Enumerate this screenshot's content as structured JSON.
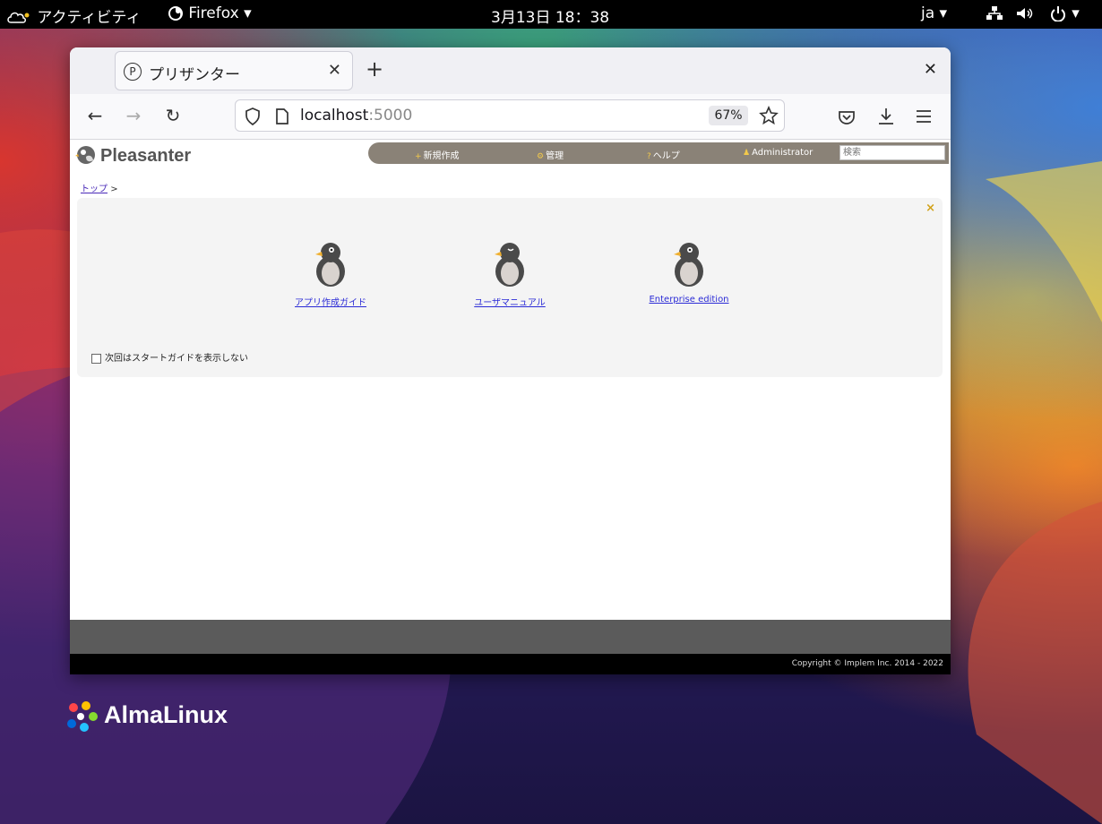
{
  "desktop": {
    "activities_label": "アクティビティ",
    "app_menu_label": "Firefox",
    "clock": "3月13日 18：38",
    "input_method": "ja",
    "distro_name": "AlmaLinux"
  },
  "browser": {
    "tab_title": "プリザンター",
    "url_host": "localhost",
    "url_port": ":5000",
    "zoom": "67%"
  },
  "app": {
    "logo_text": "Pleasanter",
    "menu": {
      "new_label": "新規作成",
      "manage_label": "管理",
      "help_label": "ヘルプ",
      "user_label": "Administrator"
    },
    "search_placeholder": "検索",
    "breadcrumb": {
      "top_label": "トップ",
      "separator": ">"
    },
    "guide": {
      "close_symbol": "×",
      "items": [
        {
          "label": "アプリ作成ガイド"
        },
        {
          "label": "ユーザマニュアル"
        },
        {
          "label": "Enterprise edition"
        }
      ],
      "dont_show_label": "次回はスタートガイドを表示しない"
    },
    "copyright": "Copyright © Implem Inc. 2014 - 2022"
  },
  "colors": {
    "menubar": "#8a8277",
    "accent_gold": "#d2a21a",
    "link_blue": "#2b2bd6"
  }
}
